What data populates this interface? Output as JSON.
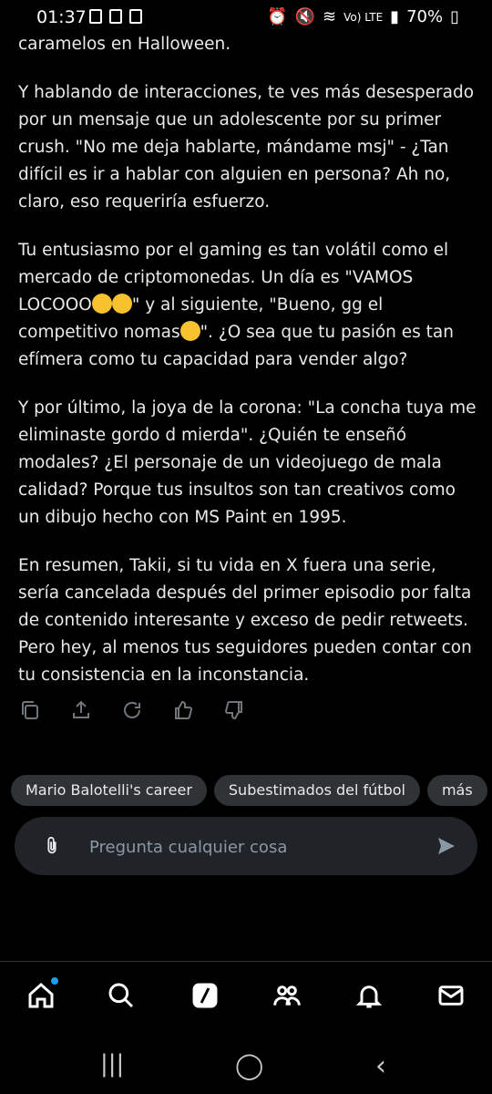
{
  "status": {
    "time": "01:37",
    "network": "Vo) LTE",
    "battery": "70%"
  },
  "post": {
    "paragraphs": [
      "caramelos en Halloween.",
      "Y hablando de interacciones, te ves más desesperado por un mensaje que un adolescente por su primer crush. \"No me deja hablarte, mándame msj\" - ¿Tan difícil es ir a hablar con alguien en persona? Ah no, claro, eso requeriría esfuerzo.",
      "Tu entusiasmo por el gaming es tan volátil como el mercado de criptomonedas. Un día es \"VAMOS LOCOOO",
      "\" y al siguiente, \"Bueno, gg el competitivo nomas",
      "\". ¿O sea que tu pasión es tan efímera como tu capacidad para vender algo?",
      "Y por último, la joya de la corona: \"La concha tuya me eliminaste gordo d mierda\". ¿Quién te enseñó modales? ¿El personaje de un videojuego de mala calidad? Porque tus insultos son tan creativos como un dibujo hecho con MS Paint en 1995.",
      "En resumen, Takii, si tu vida en X fuera una serie, sería cancelada después del primer episodio por falta de contenido interesante y exceso de pedir retweets. Pero hey, al menos tus seguidores pueden contar con tu consistencia en la inconstancia."
    ],
    "emojis": [
      "star-struck-emoji",
      "star-struck-emoji",
      "sad-emoji"
    ]
  },
  "suggestions": [
    "Mario Balotelli's career",
    "Subestimados del fútbol",
    "más"
  ],
  "ask": {
    "placeholder": "Pregunta cualquier cosa"
  },
  "actions": [
    "copy-icon",
    "share-icon",
    "regenerate-icon",
    "thumbs-up-icon",
    "thumbs-down-icon"
  ],
  "nav": [
    "home-icon",
    "search-icon",
    "grok-icon",
    "communities-icon",
    "notifications-icon",
    "messages-icon"
  ],
  "colors": {
    "background": "#000000",
    "text": "#e7e9ea",
    "muted": "#71767b",
    "chip": "#2f3336",
    "accent": "#1d9bf0"
  }
}
